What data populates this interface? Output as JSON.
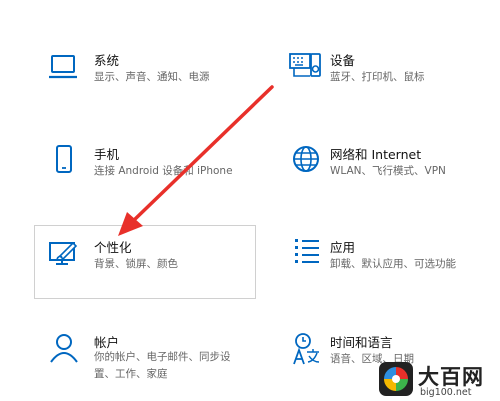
{
  "settings": {
    "accent_color": "#0067c0",
    "tiles": [
      {
        "id": "system",
        "icon": "laptop-icon",
        "title": "系统",
        "desc": [
          "显示、声音、通知、电源"
        ]
      },
      {
        "id": "devices",
        "icon": "devices-icon",
        "title": "设备",
        "desc": [
          "蓝牙、打印机、鼠标"
        ]
      },
      {
        "id": "phone",
        "icon": "phone-icon",
        "title": "手机",
        "desc": [
          "连接 Android 设备和 iPhone"
        ]
      },
      {
        "id": "network",
        "icon": "globe-icon",
        "title": "网络和 Internet",
        "desc": [
          "WLAN、飞行模式、VPN"
        ]
      },
      {
        "id": "personalization",
        "icon": "personalization-icon",
        "title": "个性化",
        "desc": [
          "背景、锁屏、颜色"
        ]
      },
      {
        "id": "apps",
        "icon": "apps-list-icon",
        "title": "应用",
        "desc": [
          "卸载、默认应用、可选功能"
        ]
      },
      {
        "id": "accounts",
        "icon": "account-icon",
        "title": "帐户",
        "desc": [
          "你的帐户、电子邮件、同步设",
          "置、工作、家庭"
        ]
      },
      {
        "id": "time-language",
        "icon": "time-language-icon",
        "title": "时间和语言",
        "desc": [
          "语音、区域、日期"
        ]
      }
    ]
  },
  "annotation": {
    "arrow_color": "#e8302a"
  },
  "watermark": {
    "brand": "大百网",
    "site": "big100.net"
  }
}
